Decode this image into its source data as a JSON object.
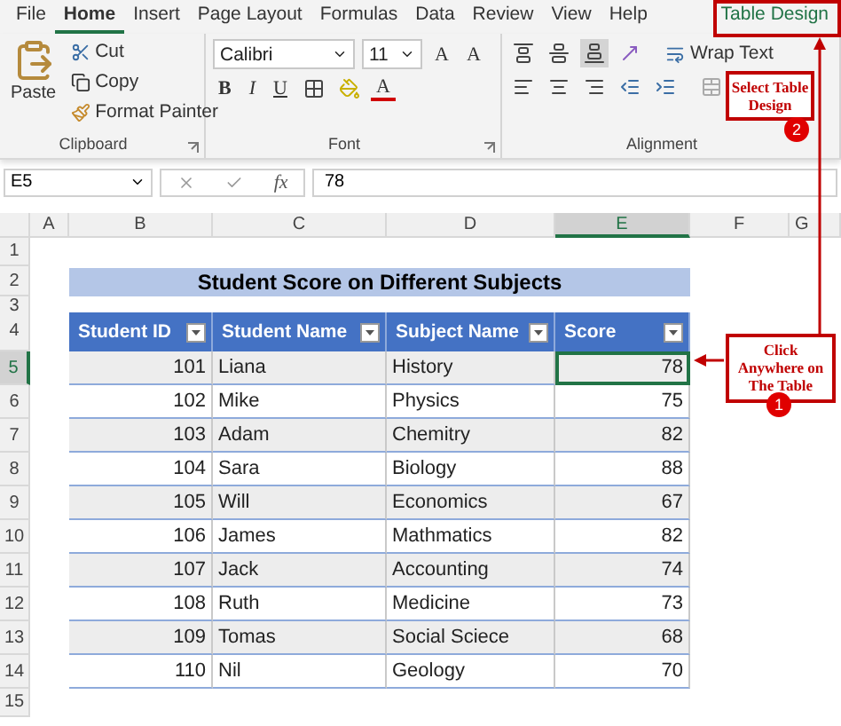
{
  "ribbon_tabs": [
    {
      "label": "File",
      "selected": false,
      "kind": "normal"
    },
    {
      "label": "Home",
      "selected": true,
      "kind": "normal"
    },
    {
      "label": "Insert",
      "selected": false,
      "kind": "normal"
    },
    {
      "label": "Page Layout",
      "selected": false,
      "kind": "normal"
    },
    {
      "label": "Formulas",
      "selected": false,
      "kind": "normal"
    },
    {
      "label": "Data",
      "selected": false,
      "kind": "normal"
    },
    {
      "label": "Review",
      "selected": false,
      "kind": "normal"
    },
    {
      "label": "View",
      "selected": false,
      "kind": "normal"
    },
    {
      "label": "Help",
      "selected": false,
      "kind": "normal"
    },
    {
      "label": "Table Design",
      "selected": false,
      "kind": "contextual"
    }
  ],
  "clipboard": {
    "paste": "Paste",
    "cut": "Cut",
    "copy": "Copy",
    "format_painter": "Format Painter",
    "label": "Clipboard"
  },
  "font": {
    "name": "Calibri",
    "size": "11",
    "grow": "A",
    "shrink": "A",
    "bold": "B",
    "italic": "I",
    "underline": "U",
    "color_letter": "A",
    "label": "Font"
  },
  "alignment": {
    "wrap_text": "Wrap Text",
    "label": "Alignment"
  },
  "formula_bar": {
    "name_box": "E5",
    "fx": "fx",
    "formula": "78"
  },
  "columns": [
    {
      "label": "A",
      "selected": false
    },
    {
      "label": "B",
      "selected": false
    },
    {
      "label": "C",
      "selected": false
    },
    {
      "label": "D",
      "selected": false
    },
    {
      "label": "E",
      "selected": true
    },
    {
      "label": "F",
      "selected": false
    },
    {
      "label": "G",
      "selected": false
    }
  ],
  "row_numbers": [
    {
      "label": "1",
      "selected": false
    },
    {
      "label": "2",
      "selected": false
    },
    {
      "label": "3",
      "selected": false
    },
    {
      "label": "4",
      "selected": false
    },
    {
      "label": "5",
      "selected": true
    },
    {
      "label": "6",
      "selected": false
    },
    {
      "label": "7",
      "selected": false
    },
    {
      "label": "8",
      "selected": false
    },
    {
      "label": "9",
      "selected": false
    },
    {
      "label": "10",
      "selected": false
    },
    {
      "label": "11",
      "selected": false
    },
    {
      "label": "12",
      "selected": false
    },
    {
      "label": "13",
      "selected": false
    },
    {
      "label": "14",
      "selected": false
    },
    {
      "label": "15",
      "selected": false
    }
  ],
  "table": {
    "title": "Student Score on Different Subjects",
    "headers": [
      "Student ID",
      "Student Name",
      "Subject Name",
      "Score"
    ],
    "rows": [
      {
        "cells": [
          "101",
          "Liana",
          "History",
          "78"
        ],
        "score_selected": true
      },
      {
        "cells": [
          "102",
          "Mike",
          "Physics",
          "75"
        ],
        "score_selected": false
      },
      {
        "cells": [
          "103",
          "Adam",
          "Chemitry",
          "82"
        ],
        "score_selected": false
      },
      {
        "cells": [
          "104",
          "Sara",
          "Biology",
          "88"
        ],
        "score_selected": false
      },
      {
        "cells": [
          "105",
          "Will",
          "Economics",
          "67"
        ],
        "score_selected": false
      },
      {
        "cells": [
          "106",
          "James",
          "Mathmatics",
          "82"
        ],
        "score_selected": false
      },
      {
        "cells": [
          "107",
          "Jack",
          "Accounting",
          "74"
        ],
        "score_selected": false
      },
      {
        "cells": [
          "108",
          "Ruth",
          "Medicine",
          "73"
        ],
        "score_selected": false
      },
      {
        "cells": [
          "109",
          "Tomas",
          "Social Sciece",
          "68"
        ],
        "score_selected": false
      },
      {
        "cells": [
          "110",
          "Nil",
          "Geology",
          "70"
        ],
        "score_selected": false
      }
    ]
  },
  "callouts": [
    {
      "text": "Select Table Design",
      "badge": "2"
    },
    {
      "text": "Click Anywhere on The Table",
      "badge": "1"
    }
  ]
}
